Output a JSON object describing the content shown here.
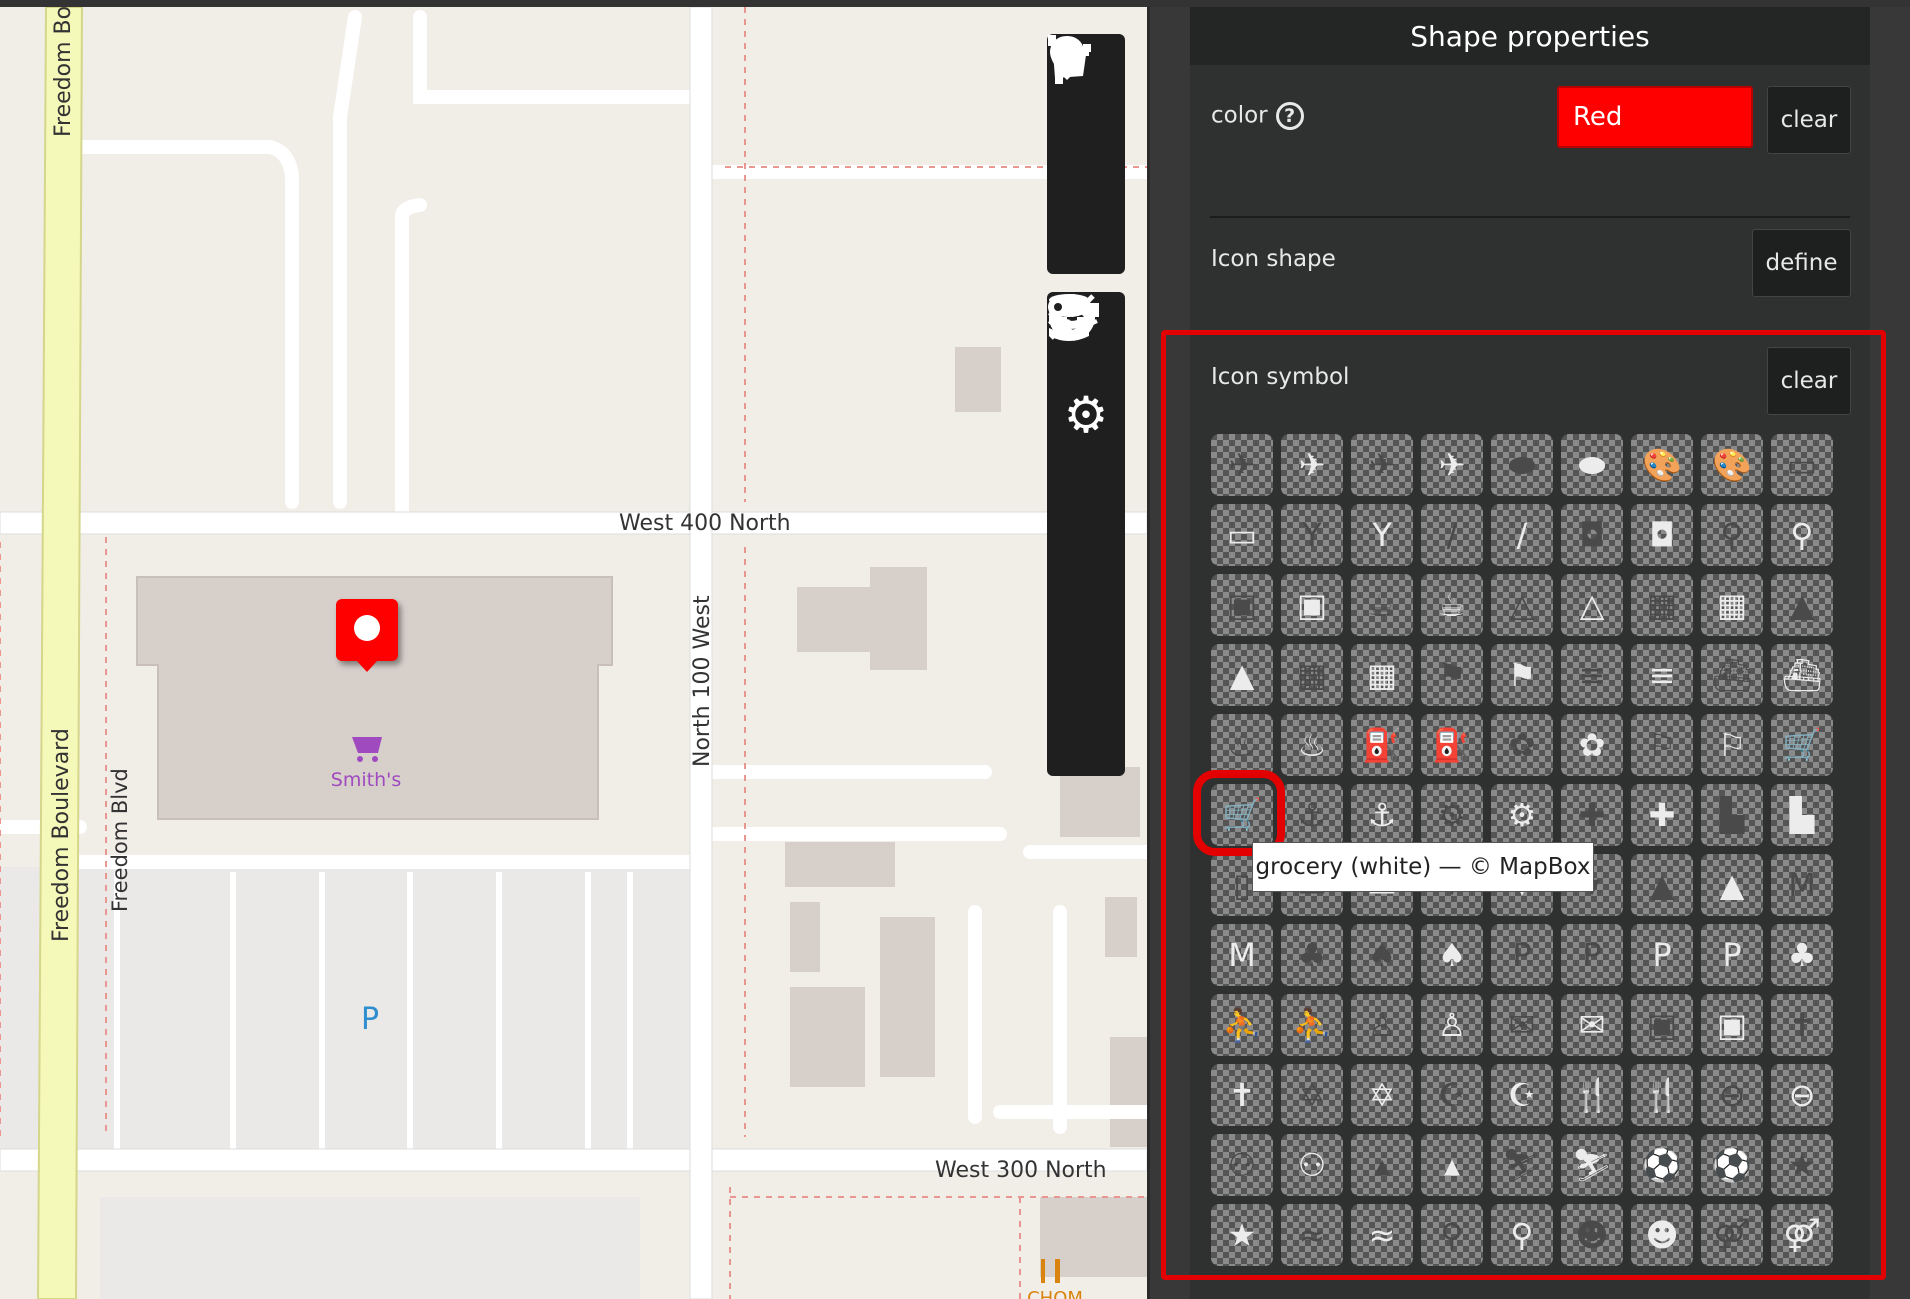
{
  "map": {
    "roads": {
      "freedom_boulevard_top": "Freedom Bo",
      "freedom_boulevard": "Freedom Boulevard",
      "freedom_blvd": "Freedom Blvd",
      "west_400_north": "West 400 North",
      "north_100_west": "North 100 West",
      "west_300_north": "West 300 North"
    },
    "poi": {
      "smiths": "Smith's",
      "parking": "P",
      "restaurant": "CHOM"
    },
    "marker_color": "#ff0000",
    "toolbar_top": [
      "marker-icon",
      "line-icon",
      "polygon-icon"
    ],
    "toolbar_bottom": [
      "upload-icon",
      "settings-icon",
      "layers-icon",
      "database-icon",
      "collapse-icon",
      "key-icon"
    ]
  },
  "panel": {
    "title": "Shape properties",
    "color_label": "color",
    "help_glyph": "?",
    "color_value": "Red",
    "color_clear": "clear",
    "icon_shape_label": "Icon shape",
    "icon_shape_define": "define",
    "icon_symbol_label": "Icon symbol",
    "icon_symbol_clear": "clear",
    "tooltip": "grocery (white) — © MapBox",
    "selected_icon": "grocery (white)",
    "highlight_color": "#e30000"
  },
  "icons": [
    {
      "name": "airfield-dark-icon",
      "g": "✈",
      "c": "dark"
    },
    {
      "name": "airfield-white-icon",
      "g": "✈",
      "c": "white"
    },
    {
      "name": "airport-dark-icon",
      "g": "✈",
      "c": "dark"
    },
    {
      "name": "airport-white-icon",
      "g": "✈",
      "c": "white"
    },
    {
      "name": "american-football-dark-icon",
      "g": "⬬",
      "c": "dark"
    },
    {
      "name": "american-football-white-icon",
      "g": "⬬",
      "c": "white"
    },
    {
      "name": "art-gallery-dark-icon",
      "g": "🎨",
      "c": "dark"
    },
    {
      "name": "art-gallery-white-icon",
      "g": "🎨",
      "c": "white"
    },
    {
      "name": "bank-dark-icon",
      "g": "▭",
      "c": "dark"
    },
    {
      "name": "bank-white-icon",
      "g": "▭",
      "c": "white"
    },
    {
      "name": "bar-dark-icon",
      "g": "Y",
      "c": "dark"
    },
    {
      "name": "bar-white-icon",
      "g": "Y",
      "c": "white"
    },
    {
      "name": "baseball-dark-icon",
      "g": "/",
      "c": "dark"
    },
    {
      "name": "baseball-white-icon",
      "g": "/",
      "c": "white"
    },
    {
      "name": "basketball-dark-icon",
      "g": "◘",
      "c": "dark"
    },
    {
      "name": "basketball-white-icon",
      "g": "◘",
      "c": "white"
    },
    {
      "name": "bicycle-dark-icon",
      "g": "⚲",
      "c": "dark"
    },
    {
      "name": "bicycle-white-icon",
      "g": "⚲",
      "c": "white"
    },
    {
      "name": "bus-dark-icon",
      "g": "▣",
      "c": "dark"
    },
    {
      "name": "bus-white-icon",
      "g": "▣",
      "c": "white"
    },
    {
      "name": "cafe-dark-icon",
      "g": "☕",
      "c": "dark"
    },
    {
      "name": "cafe-white-icon",
      "g": "☕",
      "c": "white"
    },
    {
      "name": "campsite-dark-icon",
      "g": "△",
      "c": "dark"
    },
    {
      "name": "campsite-white-icon",
      "g": "△",
      "c": "white"
    },
    {
      "name": "cinema-dark-icon",
      "g": "▦",
      "c": "dark"
    },
    {
      "name": "cinema-white-icon",
      "g": "▦",
      "c": "white"
    },
    {
      "name": "college-dark-icon",
      "g": "▲",
      "c": "dark"
    },
    {
      "name": "college-white-icon",
      "g": "▲",
      "c": "white"
    },
    {
      "name": "commercial-dark-icon",
      "g": "▦",
      "c": "dark"
    },
    {
      "name": "commercial-white-icon",
      "g": "▦",
      "c": "white"
    },
    {
      "name": "embassy-dark-icon",
      "g": "⚑",
      "c": "dark"
    },
    {
      "name": "embassy-white-icon",
      "g": "⚑",
      "c": "white"
    },
    {
      "name": "fast-food-dark-icon",
      "g": "≡",
      "c": "dark"
    },
    {
      "name": "fast-food-white-icon",
      "g": "≡",
      "c": "white"
    },
    {
      "name": "ferry-dark-icon",
      "g": "⛴",
      "c": "dark"
    },
    {
      "name": "ferry-white-icon",
      "g": "⛴",
      "c": "white"
    },
    {
      "name": "fire-station-dark-icon",
      "g": "♨",
      "c": "dark"
    },
    {
      "name": "fire-station-white-icon",
      "g": "♨",
      "c": "white"
    },
    {
      "name": "fuel-dark-icon",
      "g": "⛽",
      "c": "dark"
    },
    {
      "name": "fuel-white-icon",
      "g": "⛽",
      "c": "white"
    },
    {
      "name": "garden-dark-icon",
      "g": "✿",
      "c": "dark"
    },
    {
      "name": "garden-white-icon",
      "g": "✿",
      "c": "white"
    },
    {
      "name": "golf-dark-icon",
      "g": "⚐",
      "c": "dark"
    },
    {
      "name": "golf-white-icon",
      "g": "⚐",
      "c": "white"
    },
    {
      "name": "grocery-dark-icon",
      "g": "🛒",
      "c": "dark"
    },
    {
      "name": "grocery-white-icon",
      "g": "🛒",
      "c": "white"
    },
    {
      "name": "harbor-dark-icon",
      "g": "⚓",
      "c": "dark"
    },
    {
      "name": "harbor-white-icon",
      "g": "⚓",
      "c": "white"
    },
    {
      "name": "heliport-dark-icon",
      "g": "⚙",
      "c": "dark"
    },
    {
      "name": "heliport-white-icon",
      "g": "⚙",
      "c": "white"
    },
    {
      "name": "hospital-dark-icon",
      "g": "✚",
      "c": "dark"
    },
    {
      "name": "hospital-white-icon",
      "g": "✚",
      "c": "white"
    },
    {
      "name": "industrial-dark-icon",
      "g": "▙",
      "c": "dark"
    },
    {
      "name": "industrial-white-icon",
      "g": "▙",
      "c": "white"
    },
    {
      "name": "library-dark-icon",
      "g": "▯",
      "c": "dark"
    },
    {
      "name": "lodging-dark-icon",
      "g": "▬",
      "c": "dark"
    },
    {
      "name": "lodging-white-icon",
      "g": "▬",
      "c": "white"
    },
    {
      "name": "marker-dark-icon",
      "g": "▾",
      "c": "dark"
    },
    {
      "name": "marker-white-icon",
      "g": "▾",
      "c": "white"
    },
    {
      "name": "marker-stroked-icon",
      "g": "▾",
      "c": "dark"
    },
    {
      "name": "monument-dark-icon",
      "g": "▲",
      "c": "dark"
    },
    {
      "name": "monument-white-icon",
      "g": "▲",
      "c": "white"
    },
    {
      "name": "museum-dark-icon",
      "g": "M",
      "c": "dark"
    },
    {
      "name": "museum-white-icon",
      "g": "M",
      "c": "white"
    },
    {
      "name": "park-dark-icon",
      "g": "♣",
      "c": "dark"
    },
    {
      "name": "park2-dark-icon",
      "g": "♠",
      "c": "dark"
    },
    {
      "name": "park2-white-icon",
      "g": "♠",
      "c": "white"
    },
    {
      "name": "parking-dark-icon",
      "g": "P",
      "c": "dark"
    },
    {
      "name": "parking-garage-dark-icon",
      "g": "P",
      "c": "dark"
    },
    {
      "name": "parking-garage-white-icon",
      "g": "P",
      "c": "white"
    },
    {
      "name": "parking-white-icon",
      "g": "P",
      "c": "white"
    },
    {
      "name": "park-white-icon",
      "g": "♣",
      "c": "white"
    },
    {
      "name": "pitch-dark-icon",
      "g": "⛹",
      "c": "dark"
    },
    {
      "name": "pitch-white-icon",
      "g": "⛹",
      "c": "white"
    },
    {
      "name": "police-dark-icon",
      "g": "♙",
      "c": "dark"
    },
    {
      "name": "police-white-icon",
      "g": "♙",
      "c": "white"
    },
    {
      "name": "post-dark-icon",
      "g": "✉",
      "c": "dark"
    },
    {
      "name": "post-white-icon",
      "g": "✉",
      "c": "white"
    },
    {
      "name": "rail-dark-icon",
      "g": "▣",
      "c": "dark"
    },
    {
      "name": "rail-white-icon",
      "g": "▣",
      "c": "white"
    },
    {
      "name": "religious-christian-dark-icon",
      "g": "✝",
      "c": "dark"
    },
    {
      "name": "religious-christian-white-icon",
      "g": "✝",
      "c": "white"
    },
    {
      "name": "religious-jewish-dark-icon",
      "g": "✡",
      "c": "dark"
    },
    {
      "name": "religious-jewish-white-icon",
      "g": "✡",
      "c": "white"
    },
    {
      "name": "religious-muslim-dark-icon",
      "g": "☪",
      "c": "dark"
    },
    {
      "name": "religious-muslim-white-icon",
      "g": "☪",
      "c": "white"
    },
    {
      "name": "restaurant-dark-icon",
      "g": "🍴",
      "c": "dark"
    },
    {
      "name": "restaurant-white-icon",
      "g": "🍴",
      "c": "white"
    },
    {
      "name": "roadblock-dark-icon",
      "g": "⊖",
      "c": "dark"
    },
    {
      "name": "roadblock-white-icon",
      "g": "⊖",
      "c": "white"
    },
    {
      "name": "school-dark-icon",
      "g": "⚇",
      "c": "dark"
    },
    {
      "name": "school-white-icon",
      "g": "⚇",
      "c": "white"
    },
    {
      "name": "shop-dark-icon",
      "g": "▴",
      "c": "dark"
    },
    {
      "name": "shop-white-icon",
      "g": "▴",
      "c": "white"
    },
    {
      "name": "skiing-dark-icon",
      "g": "⛷",
      "c": "dark"
    },
    {
      "name": "skiing-white-icon",
      "g": "⛷",
      "c": "white"
    },
    {
      "name": "soccer-dark-icon",
      "g": "⚽",
      "c": "dark"
    },
    {
      "name": "soccer-white-icon",
      "g": "⚽",
      "c": "white"
    },
    {
      "name": "star-dark-icon",
      "g": "★",
      "c": "dark"
    },
    {
      "name": "star-white-icon",
      "g": "★",
      "c": "white"
    },
    {
      "name": "swimming-dark-icon",
      "g": "≈",
      "c": "dark"
    },
    {
      "name": "swimming-white-icon",
      "g": "≈",
      "c": "white"
    },
    {
      "name": "tennis-dark-icon",
      "g": "⚲",
      "c": "dark"
    },
    {
      "name": "tennis-white-icon",
      "g": "⚲",
      "c": "white"
    },
    {
      "name": "theatre-dark-icon",
      "g": "☻",
      "c": "dark"
    },
    {
      "name": "theatre-white-icon",
      "g": "☻",
      "c": "white"
    },
    {
      "name": "toilets-dark-icon",
      "g": "⚤",
      "c": "dark"
    },
    {
      "name": "toilets-white-icon",
      "g": "⚤",
      "c": "white"
    }
  ]
}
